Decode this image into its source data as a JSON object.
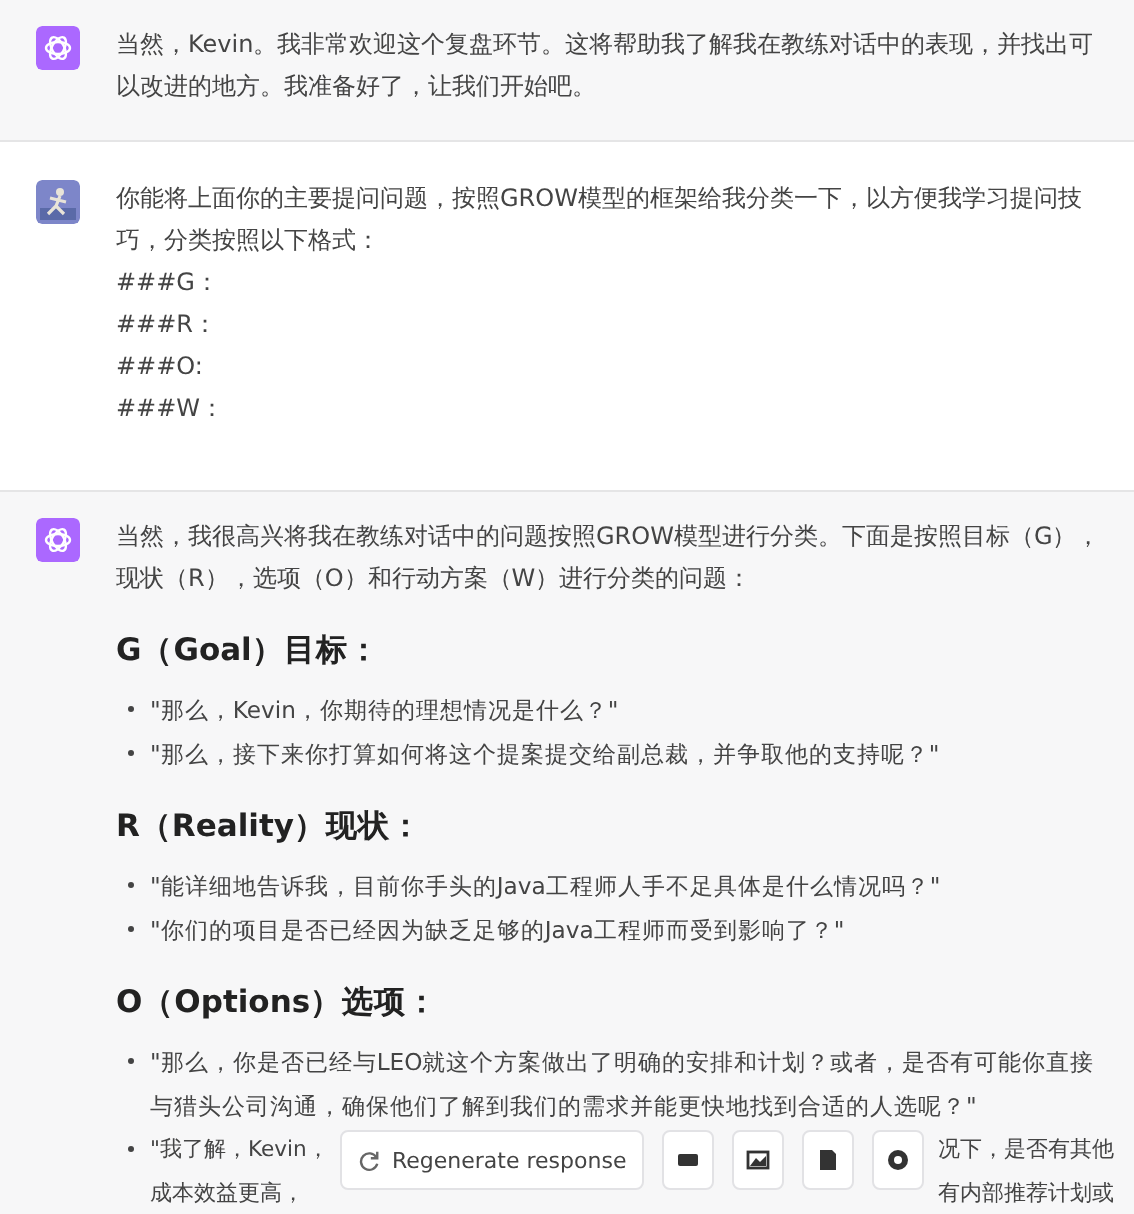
{
  "messages": [
    {
      "kind": "assistant",
      "paragraphs": [
        "当然，Kevin。我非常欢迎这个复盘环节。这将帮助我了解我在教练对话中的表现，并找出可以改进的地方。我准备好了，让我们开始吧。"
      ]
    },
    {
      "kind": "user",
      "paragraphs": [
        "你能将上面你的主要提问问题，按照GROW模型的框架给我分类一下，以方便我学习提问技巧，分类按照以下格式：",
        "###G：",
        "###R：",
        "###O:",
        "###W："
      ]
    },
    {
      "kind": "assistant",
      "paragraphs": [
        "当然，我很高兴将我在教练对话中的问题按照GROW模型进行分类。下面是按照目标（G），现状（R），选项（O）和行动方案（W）进行分类的问题："
      ],
      "sections": [
        {
          "heading": "G（Goal）目标：",
          "bullets": [
            "\"那么，Kevin，你期待的理想情况是什么？\"",
            "\"那么，接下来你打算如何将这个提案提交给副总裁，并争取他的支持呢？\""
          ]
        },
        {
          "heading": "R（Reality）现状：",
          "bullets": [
            "\"能详细地告诉我，目前你手头的Java工程师人手不足具体是什么情况吗？\"",
            "\"你们的项目是否已经因为缺乏足够的Java工程师而受到影响了？\""
          ]
        },
        {
          "heading": "O（Options）选项：",
          "bullets": [
            "\"那么，你是否已经与LEO就这个方案做出了明确的安排和计划？或者，是否有可能你直接与猎头公司沟通，确保他们了解到我们的需求并能更快地找到合适的人选呢？\""
          ],
          "partial_bullet": [
            [
              "\"我了解，Kevin，",
              "况下，是否有其他"
            ],
            [
              "成本效益更高，",
              "有内部推荐计划或"
            ]
          ]
        }
      ]
    }
  ],
  "regenerate_button": "Regenerate response"
}
